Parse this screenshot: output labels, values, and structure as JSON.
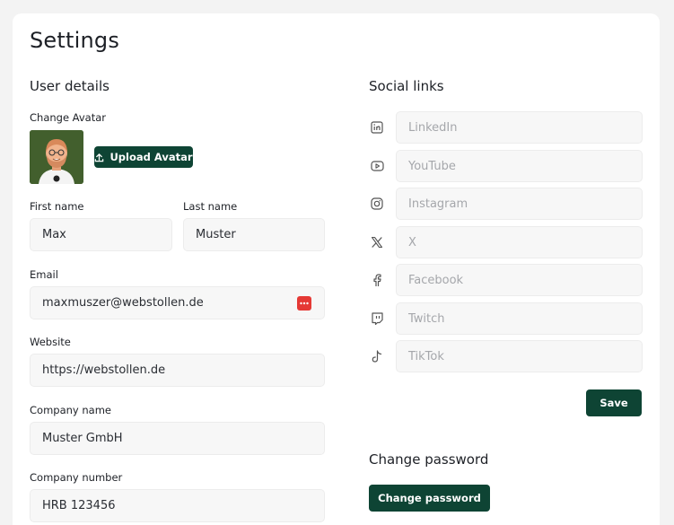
{
  "page": {
    "title": "Settings"
  },
  "user_details": {
    "title": "User details",
    "avatar_label": "Change Avatar",
    "upload_label": "Upload Avatar",
    "first_name": {
      "label": "First name",
      "value": "Max"
    },
    "last_name": {
      "label": "Last name",
      "value": "Muster"
    },
    "email": {
      "label": "Email",
      "value": "maxmuszer@webstollen.de"
    },
    "website": {
      "label": "Website",
      "value": "https://webstollen.de"
    },
    "company_name": {
      "label": "Company name",
      "value": "Muster GmbH"
    },
    "company_number": {
      "label": "Company number",
      "value": "HRB 123456"
    }
  },
  "social": {
    "title": "Social links",
    "items": [
      {
        "icon": "linkedin-icon",
        "placeholder": "LinkedIn"
      },
      {
        "icon": "youtube-icon",
        "placeholder": "YouTube"
      },
      {
        "icon": "instagram-icon",
        "placeholder": "Instagram"
      },
      {
        "icon": "x-icon",
        "placeholder": "X"
      },
      {
        "icon": "facebook-icon",
        "placeholder": "Facebook"
      },
      {
        "icon": "twitch-icon",
        "placeholder": "Twitch"
      },
      {
        "icon": "tiktok-icon",
        "placeholder": "TikTok"
      }
    ],
    "save_label": "Save"
  },
  "password": {
    "title": "Change password",
    "button_label": "Change password"
  },
  "colors": {
    "brand": "#0e4434",
    "background": "#f3f3f3",
    "input_bg": "#f7f7f7",
    "badge": "#e53935"
  }
}
